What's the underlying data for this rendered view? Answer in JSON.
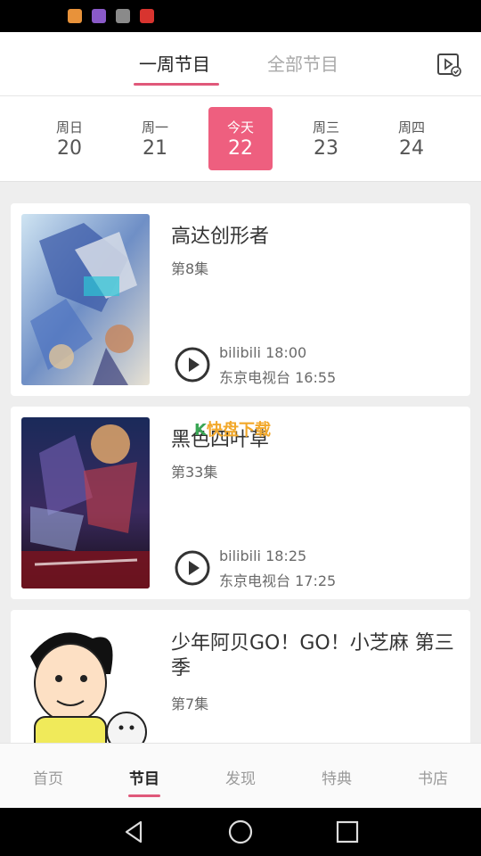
{
  "status_bar": {
    "icons": [
      "app-icon-orange",
      "app-icon-purple",
      "app-icon-gray",
      "huawei-icon"
    ],
    "colors": [
      "#e8923a",
      "#8a5ac8",
      "#8a8a8a",
      "#d8342f"
    ]
  },
  "header": {
    "tabs": [
      {
        "label": "一周节目",
        "active": true
      },
      {
        "label": "全部节目",
        "active": false
      }
    ],
    "action_icon": "play-list-icon",
    "accent_color": "#e0587a"
  },
  "dates": [
    {
      "weekday": "周日",
      "day": "20",
      "selected": false
    },
    {
      "weekday": "周一",
      "day": "21",
      "selected": false
    },
    {
      "weekday": "今天",
      "day": "22",
      "selected": true
    },
    {
      "weekday": "周三",
      "day": "23",
      "selected": false
    },
    {
      "weekday": "周四",
      "day": "24",
      "selected": false
    }
  ],
  "shows": [
    {
      "title": "高达创形者",
      "episode": "第8集",
      "schedule": [
        "bilibili 18:00",
        "东京电视台 16:55"
      ]
    },
    {
      "title": "黑色四叶草",
      "episode": "第33集",
      "schedule": [
        "bilibili 18:25",
        "东京电视台 17:25"
      ]
    },
    {
      "title": "少年阿贝GO！GO！小芝麻 第三季",
      "episode": "第7集",
      "schedule": []
    }
  ],
  "watermark": {
    "k": "K",
    "text": "快盘下载"
  },
  "bottom_nav": [
    {
      "label": "首页",
      "active": false
    },
    {
      "label": "节目",
      "active": true
    },
    {
      "label": "发现",
      "active": false
    },
    {
      "label": "特典",
      "active": false
    },
    {
      "label": "书店",
      "active": false
    }
  ]
}
